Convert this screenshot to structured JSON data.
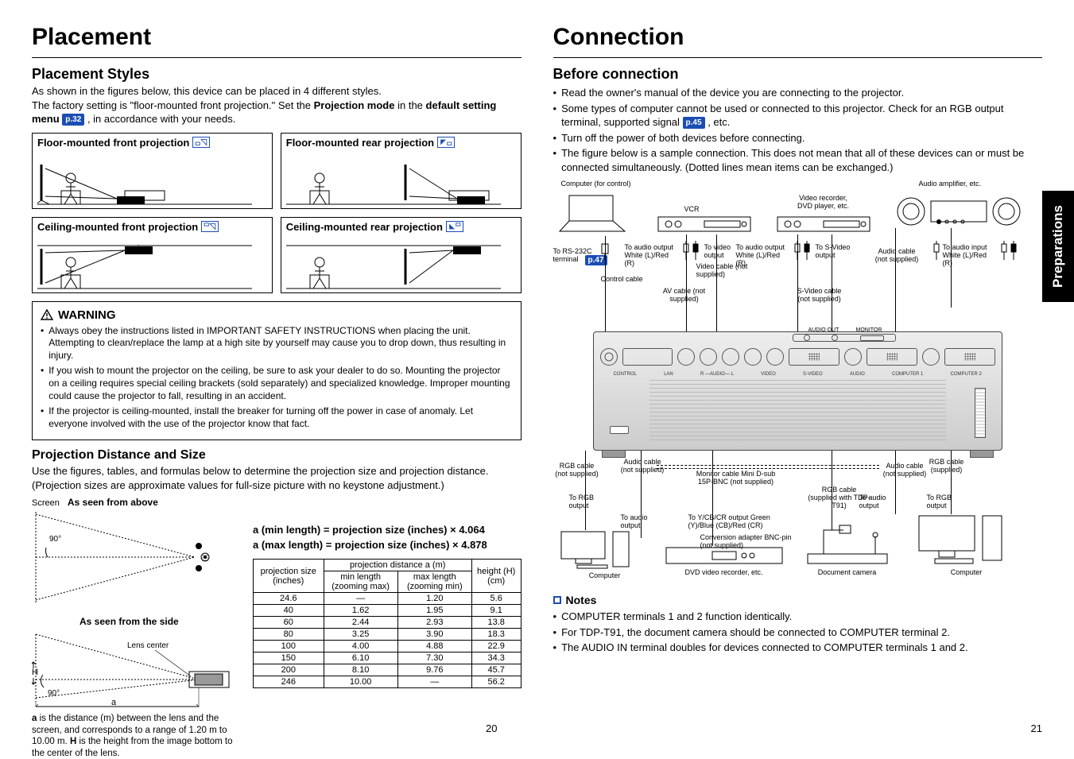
{
  "left": {
    "title": "Placement",
    "styles_head": "Placement Styles",
    "styles_p1": "As shown in the figures below, this device can be placed in 4 different styles.",
    "styles_p2a": "The factory setting is \"floor-mounted front projection.\" Set the ",
    "styles_p2b": "Projection mode",
    "styles_p2c": " in the ",
    "styles_p2d": "default setting menu ",
    "styles_pref": "p.32",
    "styles_p2e": " , in accordance with your needs.",
    "style_boxes": [
      "Floor-mounted front projection",
      "Floor-mounted rear projection",
      "Ceiling-mounted front projection",
      "Ceiling-mounted rear projection"
    ],
    "warning_head": "WARNING",
    "warning_items": [
      "Always obey the instructions listed in IMPORTANT SAFETY INSTRUCTIONS when placing the unit. Attempting to clean/replace the lamp at a high site by yourself may cause you to drop down, thus resulting in injury.",
      "If you wish to mount the projector on the ceiling, be sure to ask your dealer to do so. Mounting the projector on a ceiling requires special ceiling brackets (sold separately) and specialized knowledge. Improper mounting could cause the projector to fall, resulting in an accident.",
      "If the projector is ceiling-mounted, install the breaker for turning off the power in case of anomaly. Let everyone involved with the use of the projector know that fact."
    ],
    "dist_head": "Projection Distance and Size",
    "dist_p": "Use the figures, tables, and formulas below to determine the projection size and projection distance. (Projection sizes are approximate values for full-size picture with no keystone adjustment.)",
    "screen_lbl": "Screen",
    "above_lbl": "As seen from above",
    "side_lbl": "As seen from the side",
    "lens_lbl": "Lens center",
    "angle90": "90°",
    "a_lbl": "a",
    "h_lbl": "H",
    "formula_min": "a (min length) = projection size (inches) × 4.064",
    "formula_max": "a (max length) = projection size (inches) × 4.878",
    "table_h1": "projection size (inches)",
    "table_h2": "projection distance a (m)",
    "table_h2a": "min length (zooming max)",
    "table_h2b": "max length (zooming min)",
    "table_h3": "height (H) (cm)",
    "caption": "a is the distance (m) between the lens and the screen, and corresponds to a range of 1.20 m to 10.00 m. H is the height from the image bottom to the center of the lens.",
    "pagenum": "20"
  },
  "right": {
    "title": "Connection",
    "before_head": "Before connection",
    "before_items": [
      "Read the owner's manual of the device you are connecting to the projector.",
      "Some types of computer cannot be used or connected to this projector. Check for an RGB output terminal, supported signal ",
      "Turn off the power of both devices before connecting.",
      "The figure below is a sample connection. This does not mean that all of these devices can or must be connected simultaneously. (Dotted lines mean items can be exchanged.)"
    ],
    "pref45": "p.45",
    "pref47": "p.47",
    "etc": " , etc.",
    "fig": {
      "computer_ctrl": "Computer (for control)",
      "vcr": "VCR",
      "video_rec": "Video recorder, DVD player, etc.",
      "audio_amp": "Audio amplifier, etc.",
      "rs232": "To RS-232C terminal",
      "ctrl_cable": "Control cable",
      "to_audio_out": "To audio output White (L)/Red (R)",
      "to_video_out": "To video output",
      "video_cable": "Video cable (not supplied)",
      "av_cable": "AV cable (not supplied)",
      "to_svideo": "To S-Video output",
      "svideo_cable": "S-Video cable (not supplied)",
      "audio_cable_ns": "Audio cable (not supplied)",
      "to_audio_in": "To audio input White (L)/Red (R)",
      "rgb_cable_ns": "RGB cable (not supplied)",
      "rgb_cable_s": "RGB cable (supplied)",
      "monitor_cable": "Monitor cable Mini D-sub 15P-BNC (not supplied)",
      "rgb_cable_tdp": "RGB cable (supplied with TDP-T91)",
      "to_rgb_out": "To RGB output",
      "to_audio_out2": "To audio output",
      "to_ycbcr": "To Y/CB/CR output Green (Y)/Blue (CB)/Red (CR)",
      "conv_adapter": "Conversion adapter BNC-pin (not supplied)",
      "bottom_computer": "Computer",
      "bottom_dvd": "DVD video recorder, etc.",
      "bottom_doc": "Document camera",
      "bottom_computer2": "Computer",
      "audio_out_ctr": "AUDIO OUT",
      "monitor_lbl": "MONITOR"
    },
    "notes_head": "Notes",
    "notes_items": [
      "COMPUTER terminals 1 and 2 function identically.",
      "For TDP-T91, the document camera should be connected to COMPUTER terminal 2.",
      "The AUDIO IN terminal doubles for devices connected to COMPUTER terminals 1 and 2."
    ],
    "side_tab": "Preparations",
    "pagenum": "21"
  },
  "chart_data": {
    "type": "table",
    "title": "Projection Distance and Size",
    "columns": [
      "projection size (inches)",
      "min length (zooming max) a (m)",
      "max length (zooming min) a (m)",
      "height H (cm)"
    ],
    "rows": [
      [
        24.6,
        null,
        1.2,
        5.6
      ],
      [
        40,
        1.62,
        1.95,
        9.1
      ],
      [
        60,
        2.44,
        2.93,
        13.8
      ],
      [
        80,
        3.25,
        3.9,
        18.3
      ],
      [
        100,
        4.0,
        4.88,
        22.9
      ],
      [
        150,
        6.1,
        7.3,
        34.3
      ],
      [
        200,
        8.1,
        9.76,
        45.7
      ],
      [
        246,
        10.0,
        null,
        56.2
      ]
    ]
  }
}
